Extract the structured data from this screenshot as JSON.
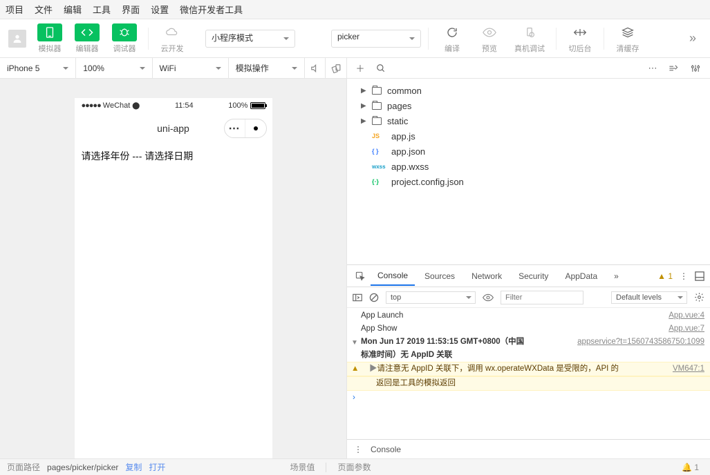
{
  "menu": [
    "项目",
    "文件",
    "编辑",
    "工具",
    "界面",
    "设置",
    "微信开发者工具"
  ],
  "toolbar": {
    "simulator": "模拟器",
    "editor": "编辑器",
    "debugger": "调试器",
    "cloud": "云开发",
    "mode": "小程序模式",
    "target": "picker",
    "compile": "编译",
    "preview": "预览",
    "remote": "真机调试",
    "background": "切后台",
    "cache": "清缓存"
  },
  "simctrl": {
    "device": "iPhone 5",
    "zoom": "100%",
    "network": "WiFi",
    "sim": "模拟操作"
  },
  "phone": {
    "carrier": "WeChat",
    "wifi": "📶",
    "time": "11:54",
    "battery": "100%",
    "title": "uni-app",
    "content": "请选择年份 --- 请选择日期"
  },
  "tree": [
    {
      "type": "folder",
      "name": "common"
    },
    {
      "type": "folder",
      "name": "pages"
    },
    {
      "type": "folder",
      "name": "static"
    },
    {
      "type": "file",
      "badge": "JS",
      "cls": "js-b",
      "name": "app.js"
    },
    {
      "type": "file",
      "badge": "{ }",
      "cls": "json-b",
      "name": "app.json"
    },
    {
      "type": "file",
      "badge": "wxss",
      "cls": "wxss-b",
      "name": "app.wxss"
    },
    {
      "type": "file",
      "badge": "{⋅}",
      "cls": "cfg-b",
      "name": "project.config.json"
    }
  ],
  "devtabs": [
    "Console",
    "Sources",
    "Network",
    "Security",
    "AppData"
  ],
  "devtabs_active": 0,
  "warn_count": "1",
  "filter": {
    "context": "top",
    "placeholder": "Filter",
    "levels": "Default levels"
  },
  "console": {
    "r1_msg": "App Launch",
    "r1_src": "App.vue:4",
    "r2_msg": "App Show",
    "r2_src": "App.vue:7",
    "r3_a": "Mon Jun 17 2019 11:53:15 GMT+0800（中国",
    "r3_link": "appservice?t=1560743586750:1099",
    "r3_b": "标准时间）无 AppID 关联",
    "r4_a": "请注意无 AppID 关联下，调用 wx.operateWXData 是受限的，API 的",
    "r4_src": "VM647:1",
    "r4_b": "返回是工具的模拟返回"
  },
  "dt_foot": "Console",
  "status": {
    "path_label": "页面路径",
    "path": "pages/picker/picker",
    "copy": "复制",
    "open": "打开",
    "scene": "场景值",
    "params": "页面参数",
    "notif": "1"
  }
}
